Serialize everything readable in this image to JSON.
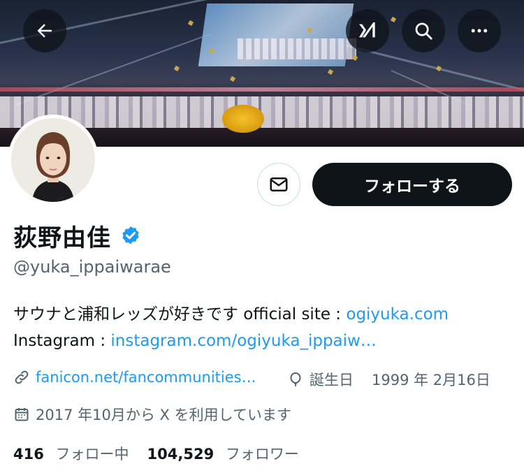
{
  "header": {
    "back_icon": "arrow-left-icon",
    "grok_icon": "grok-icon",
    "search_icon": "search-icon",
    "more_icon": "more-horizontal-icon"
  },
  "profile": {
    "name": "荻野由佳",
    "verified": true,
    "handle": "@yuka_ippaiwarae",
    "bio_text": "サウナと浦和レッズが好きです official site : ",
    "bio_site_link": "ogiyuka.com",
    "bio_instagram_label": "Instagram : ",
    "bio_instagram_link": "instagram.com/ogiyuka_ippaiw…",
    "website_link": "fanicon.net/fancommunities…",
    "birthday_label": "誕生日",
    "birthday_value": "1999 年 2月16日",
    "joined": "2017 年10月から X を利用しています",
    "following_count": "416",
    "following_label": "フォロー中",
    "followers_count": "104,529",
    "followers_label": "フォロワー"
  },
  "actions": {
    "message_icon": "mail-icon",
    "follow_label": "フォローする"
  },
  "colors": {
    "link": "#1d9bf0",
    "verified": "#1d9bf0",
    "text": "#0f1419",
    "secondary": "#536471",
    "button": "#0f1419"
  }
}
